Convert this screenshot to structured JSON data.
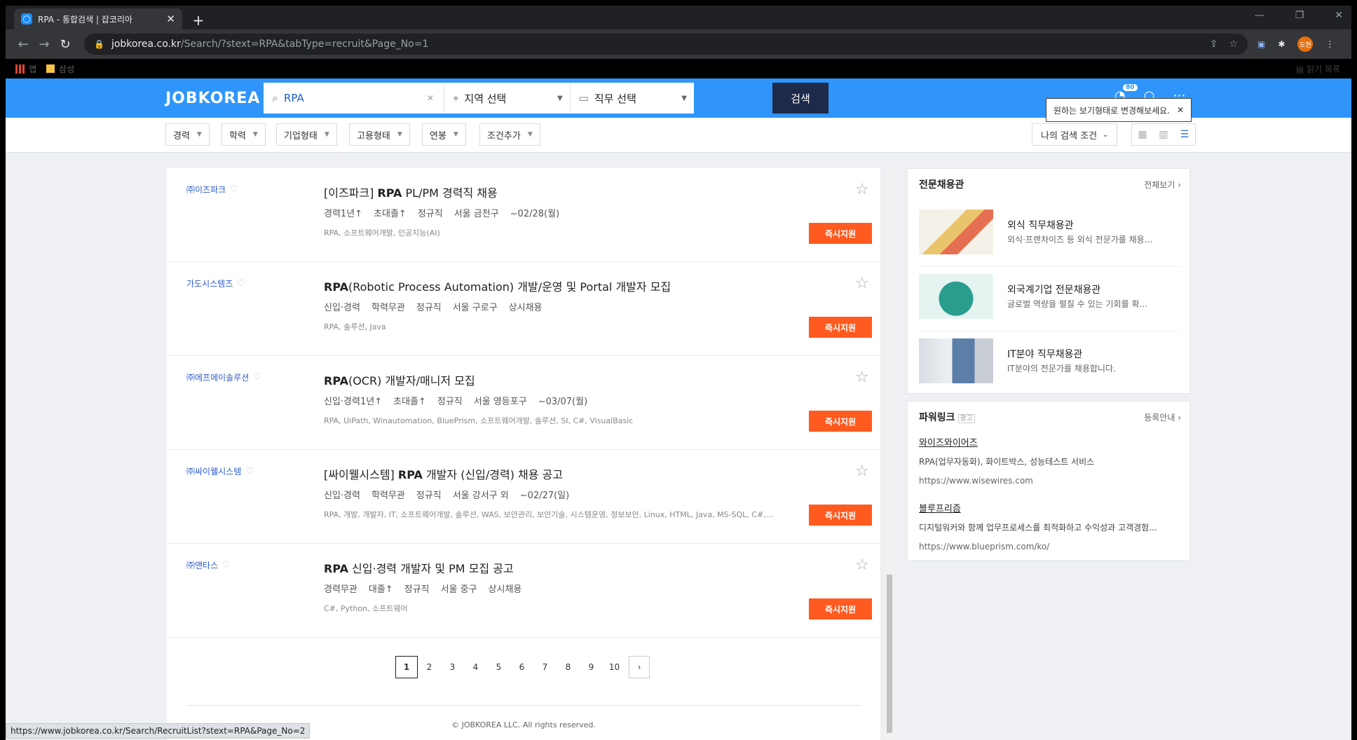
{
  "browser": {
    "tab_title": "RPA - 통합검색 | 잡코리아",
    "url_host": "jobkorea.co.kr",
    "url_path": "/Search/?stext=RPA&tabType=recruit&Page_No=1",
    "bookmarks": [
      "앱",
      "삼성"
    ],
    "reading_list": "읽기 목록",
    "profile_initial": "도현",
    "status_url": "https://www.jobkorea.co.kr/Search/RecruitList?stext=RPA&Page_No=2"
  },
  "header": {
    "logo": "JOBKOREA",
    "search_value": "RPA",
    "region_placeholder": "지역 선택",
    "job_placeholder": "직무 선택",
    "search_button": "검색",
    "notification_count": "80",
    "tooltip": "원하는 보기형태로 변경해보세요."
  },
  "filters": {
    "items": [
      "경력",
      "학력",
      "기업형태",
      "고용형태",
      "연봉",
      "조건추가"
    ],
    "my_search": "나의 검색 조건"
  },
  "jobs": [
    {
      "company": "㈜이즈파크",
      "title_pre": "[이즈파크] ",
      "title_bold": "RPA",
      "title_post": " PL/PM 경력직 채용",
      "conditions": [
        "경력1년↑",
        "초대졸↑",
        "정규직",
        "서울 금천구",
        "~02/28(월)"
      ],
      "tags": "RPA, 소프트웨어개발, 인공지능(AI)",
      "apply": "즉시지원"
    },
    {
      "company": "가도시스템즈",
      "title_pre": "",
      "title_bold": "RPA",
      "title_post": "(Robotic Process Automation) 개발/운영 및 Portal 개발자 모집",
      "conditions": [
        "신입·경력",
        "학력무관",
        "정규직",
        "서울 구로구",
        "상시채용"
      ],
      "tags": "RPA, 솔루션, Java",
      "apply": "즉시지원"
    },
    {
      "company": "㈜에프에이솔루션",
      "title_pre": "",
      "title_bold": "RPA",
      "title_post": "(OCR) 개발자/매니저 모집",
      "conditions": [
        "신입·경력1년↑",
        "초대졸↑",
        "정규직",
        "서울 영등포구",
        "~03/07(월)"
      ],
      "tags": "RPA, UiPath, Winautomation, BluePrism, 소프트웨어개발, 솔루션, SI, C#, VisualBasic",
      "apply": "즉시지원"
    },
    {
      "company": "㈜싸이웰시스템",
      "title_pre": "[싸이웰시스템] ",
      "title_bold": "RPA",
      "title_post": " 개발자 (신입/경력) 채용 공고",
      "conditions": [
        "신입·경력",
        "학력무관",
        "정규직",
        "서울 강서구 외",
        "~02/27(일)"
      ],
      "tags": "RPA, 개발, 개발자, IT, 소프트웨어개발, 솔루션, WAS, 보안관리, 보안기술, 시스템운영, 정보보안, Linux, HTML, Java, MS-SQL, C#,...",
      "apply": "즉시지원"
    },
    {
      "company": "㈜앤타스",
      "title_pre": "",
      "title_bold": "RPA",
      "title_post": " 신입·경력 개발자 및 PM 모집 공고",
      "conditions": [
        "경력무관",
        "대졸↑",
        "정규직",
        "서울 중구",
        "상시채용"
      ],
      "tags": "C#, Python, 소프트웨어",
      "apply": "즉시지원"
    }
  ],
  "pagination": {
    "pages": [
      "1",
      "2",
      "3",
      "4",
      "5",
      "6",
      "7",
      "8",
      "9",
      "10"
    ],
    "current": "1",
    "next": "›"
  },
  "footer": {
    "copyright": "© JOBKOREA LLC. All rights reserved."
  },
  "sidebar": {
    "special_title": "전문채용관",
    "special_more": "전체보기 ›",
    "special_items": [
      {
        "title": "외식 직무채용관",
        "desc": "외식·프랜차이즈 등 외식 전문가를 채용..."
      },
      {
        "title": "외국계기업 전문채용관",
        "desc": "글로벌 역량을 펼칠 수 있는 기회를 확..."
      },
      {
        "title": "IT분야 직무채용관",
        "desc": "IT분야의 전문가를 채용합니다."
      }
    ],
    "power_title": "파워링크",
    "power_tag": "광고",
    "power_more": "등록안내 ›",
    "ads": [
      {
        "name": "와이즈와이어즈",
        "desc": "RPA(업무자동화), 화이트박스, 성능테스트 서비스",
        "url": "https://www.wisewires.com"
      },
      {
        "name": "블루프리즘",
        "desc": "디지털워커와 함께 업무프로세스를 최적화하고 수익성과 고객경험...",
        "url": "https://www.blueprism.com/ko/"
      }
    ]
  },
  "colors": {
    "brand_blue": "#2f95fb",
    "apply_orange": "#ff5a1f",
    "search_navy": "#1e2a4a"
  }
}
